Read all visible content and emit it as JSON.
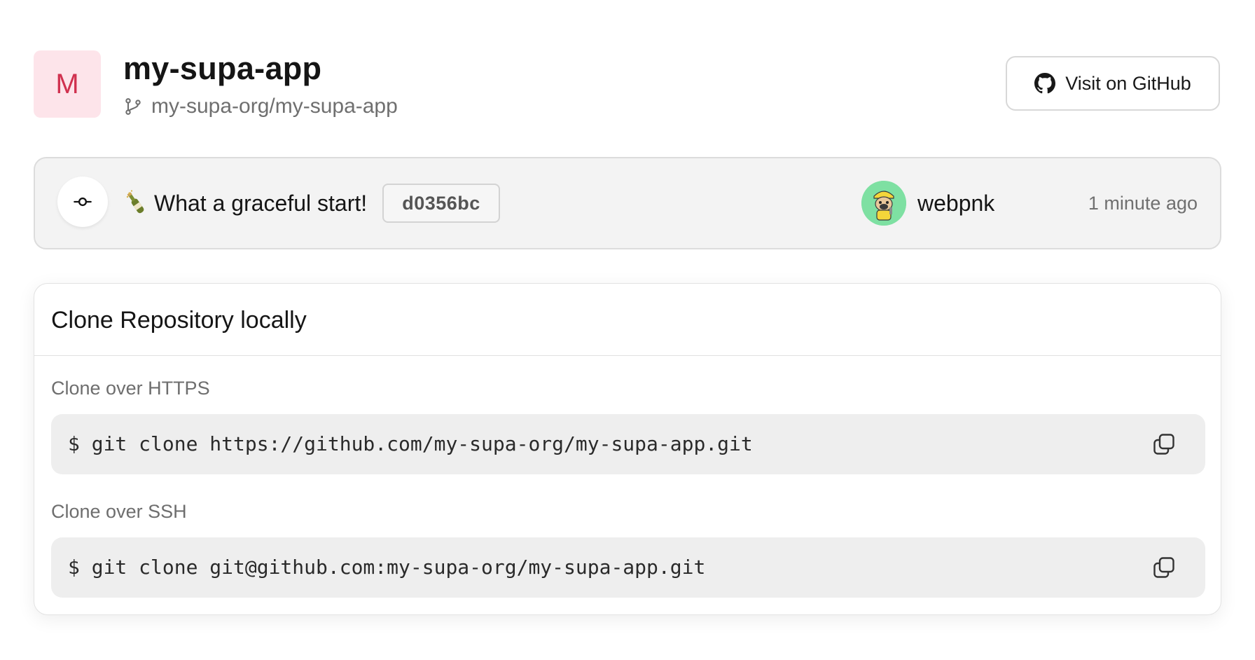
{
  "repo": {
    "avatar_letter": "M",
    "name": "my-supa-app",
    "full_path": "my-supa-org/my-supa-app",
    "avatar_bg": "#fde4ea",
    "avatar_fg": "#d0314f",
    "path_icon": "git-branch-icon"
  },
  "header": {
    "github_button_label": "Visit on GitHub",
    "github_icon": "github-icon"
  },
  "commit": {
    "icon": "git-commit-icon",
    "emoji": "bottle-with-popping-cork-emoji",
    "message": "What a graceful start!",
    "hash": "d0356bc",
    "author": "webpnk",
    "author_avatar_bg": "#7ee0a2",
    "time": "1 minute ago"
  },
  "clone": {
    "title": "Clone Repository locally",
    "https_label": "Clone over HTTPS",
    "https_command": "$ git clone https://github.com/my-supa-org/my-supa-app.git",
    "ssh_label": "Clone over SSH",
    "ssh_command": "$ git clone git@github.com:my-supa-org/my-supa-app.git",
    "copy_icon": "copy-icon"
  }
}
